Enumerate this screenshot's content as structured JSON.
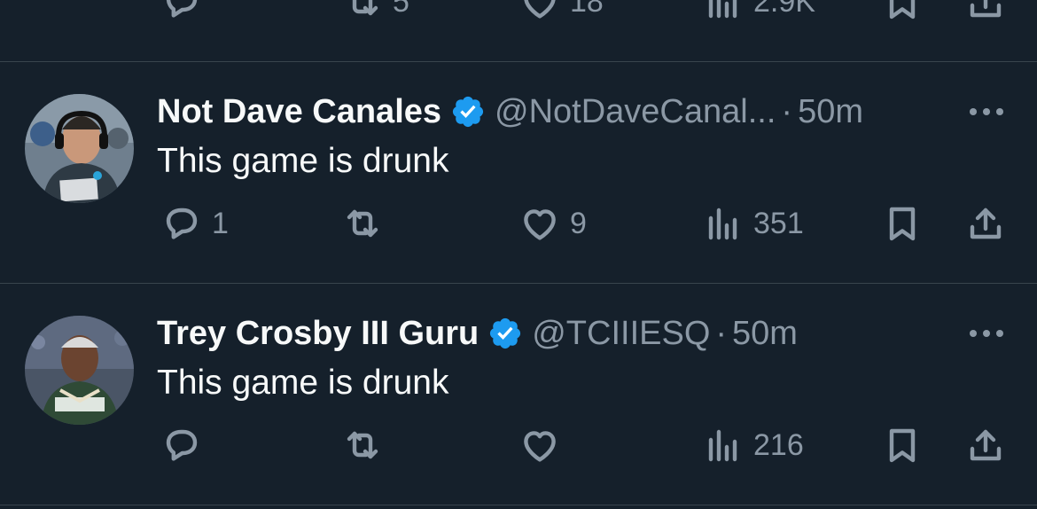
{
  "top_actions": {
    "replies": "",
    "reposts": "5",
    "likes": "18",
    "views": "2.9K"
  },
  "tweets": [
    {
      "name": "Not Dave Canales",
      "handle": "@NotDaveCanal...",
      "separator": "·",
      "time": "50m",
      "text": "This game is drunk",
      "replies": "1",
      "reposts": "",
      "likes": "9",
      "views": "351"
    },
    {
      "name": "Trey Crosby III Guru",
      "handle": "@TCIIIESQ",
      "separator": "·",
      "time": "50m",
      "text": "This game is drunk",
      "replies": "",
      "reposts": "",
      "likes": "",
      "views": "216"
    }
  ],
  "colors": {
    "background": "#15202b",
    "divider": "#38444d",
    "primary_text": "#f7f9f9",
    "secondary_text": "#8b98a5",
    "verified_badge": "#1d9bf0"
  }
}
